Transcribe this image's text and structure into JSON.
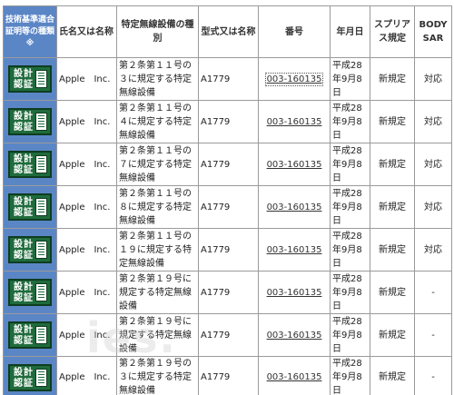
{
  "headers": {
    "cert_type": "技術基準適合証明等の種類 ※",
    "name": "氏名又は名称",
    "equipment": "特定無線設備の種別",
    "model": "型式又は名称",
    "number": "番号",
    "date": "年月日",
    "spurious": "スプリアス規定",
    "body_sar": "BODY SAR"
  },
  "badge": {
    "kanji": "設計認証",
    "icon": "certificate-document-icon"
  },
  "rows": [
    {
      "name": "Apple　Inc.",
      "equipment": "第２条第１１号の３に規定する特定無線設備",
      "model": "A1779",
      "number": "003-160135",
      "date": "平成28年9月8日",
      "spurious": "新規定",
      "body_sar": "対応"
    },
    {
      "name": "Apple　Inc.",
      "equipment": "第２条第１１号の４に規定する特定無線設備",
      "model": "A1779",
      "number": "003-160135",
      "date": "平成28年9月8日",
      "spurious": "新規定",
      "body_sar": "対応"
    },
    {
      "name": "Apple　Inc.",
      "equipment": "第２条第１１号の７に規定する特定無線設備",
      "model": "A1779",
      "number": "003-160135",
      "date": "平成28年9月8日",
      "spurious": "新規定",
      "body_sar": "対応"
    },
    {
      "name": "Apple　Inc.",
      "equipment": "第２条第１１号の８に規定する特定無線設備",
      "model": "A1779",
      "number": "003-160135",
      "date": "平成28年9月8日",
      "spurious": "新規定",
      "body_sar": "対応"
    },
    {
      "name": "Apple　Inc.",
      "equipment": "第２条第１１号の１９に規定する特定無線設備",
      "model": "A1779",
      "number": "003-160135",
      "date": "平成28年9月8日",
      "spurious": "新規定",
      "body_sar": "対応"
    },
    {
      "name": "Apple　Inc.",
      "equipment": "第２条第１９号に規定する特定無線設備",
      "model": "A1779",
      "number": "003-160135",
      "date": "平成28年9月8日",
      "spurious": "新規定",
      "body_sar": "-"
    },
    {
      "name": "Apple　Inc.",
      "equipment": "第２条第１９号に規定する特定無線設備",
      "model": "A1779",
      "number": "003-160135",
      "date": "平成28年9月8日",
      "spurious": "新規定",
      "body_sar": "-"
    },
    {
      "name": "Apple　Inc.",
      "equipment": "第２条第１９号の３に規定する特定無線設備",
      "model": "A1779",
      "number": "003-160135",
      "date": "平成28年9月8日",
      "spurious": "新規定",
      "body_sar": "-"
    }
  ],
  "watermark": "ies."
}
